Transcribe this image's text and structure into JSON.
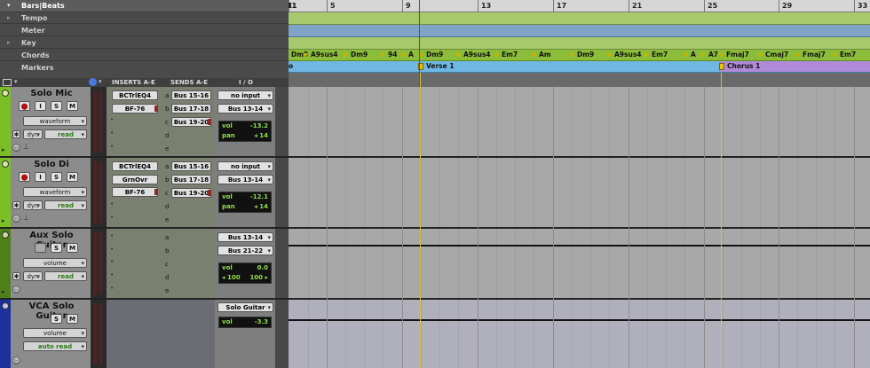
{
  "ruler": {
    "header": "Bars|Beats",
    "rows": [
      "Tempo",
      "Meter",
      "Key",
      "Chords",
      "Markers"
    ],
    "bar_numbers": [
      "1",
      "5",
      "9",
      "13",
      "17",
      "21",
      "25",
      "29",
      "33"
    ]
  },
  "chords": [
    "Dm9",
    "A9sus4",
    "Dm9",
    "94",
    "A",
    "Dm9",
    "A9sus4",
    "Em7",
    "Am",
    "Dm9",
    "A9sus4",
    "Em7",
    "A",
    "A7",
    "Fmaj7",
    "Cmaj7",
    "Fmaj7",
    "Em7"
  ],
  "markers": {
    "first": "o",
    "verse": "Verse 1",
    "chorus": "Chorus 1"
  },
  "columns": {
    "inserts": "INSERTS A-E",
    "sends": "SENDS A-E",
    "io": "I / O"
  },
  "buttons": {
    "rec": "⬤",
    "input": "I",
    "solo": "S",
    "mute": "M",
    "dyn": "dyn"
  },
  "slot_empty": "•",
  "send_letters": [
    "a",
    "b",
    "c",
    "d",
    "e"
  ],
  "tracks": [
    {
      "name": "Solo Mic",
      "view": "waveform",
      "automation": "read",
      "inserts": [
        "BCTrlEQ4",
        "BF-76"
      ],
      "sends": [
        "Bus 15-16",
        "Bus 17-18",
        "Bus 19-20"
      ],
      "io": [
        "no input",
        "Bus 13-14"
      ],
      "vol_label": "vol",
      "vol": "-13.2",
      "pan_label": "pan",
      "pan": "◂ 14",
      "color": "#7ac024"
    },
    {
      "name": "Solo Di",
      "view": "waveform",
      "automation": "read",
      "inserts": [
        "BCTrlEQ4",
        "GrnOvr",
        "BF-76"
      ],
      "sends": [
        "Bus 15-16",
        "Bus 17-18",
        "Bus 19-20"
      ],
      "io": [
        "no input",
        "Bus 13-14"
      ],
      "vol_label": "vol",
      "vol": "-12.1",
      "pan_label": "pan",
      "pan": "◂ 14",
      "color": "#7ac024"
    },
    {
      "name": "Aux Solo Guitar",
      "view": "volume",
      "automation": "read",
      "io": [
        "Bus 13-14",
        "Bus 21-22"
      ],
      "vol_label": "vol",
      "vol": "0.0",
      "pan_l": "◂ 100",
      "pan_r": "100 ▸",
      "color": "#4f7f18"
    },
    {
      "name": "VCA Solo Guitar",
      "view": "volume",
      "automation": "auto read",
      "io": [
        "Solo Guitar"
      ],
      "vol_label": "vol",
      "vol": "-3.3",
      "color": "#1e2f9e"
    }
  ]
}
